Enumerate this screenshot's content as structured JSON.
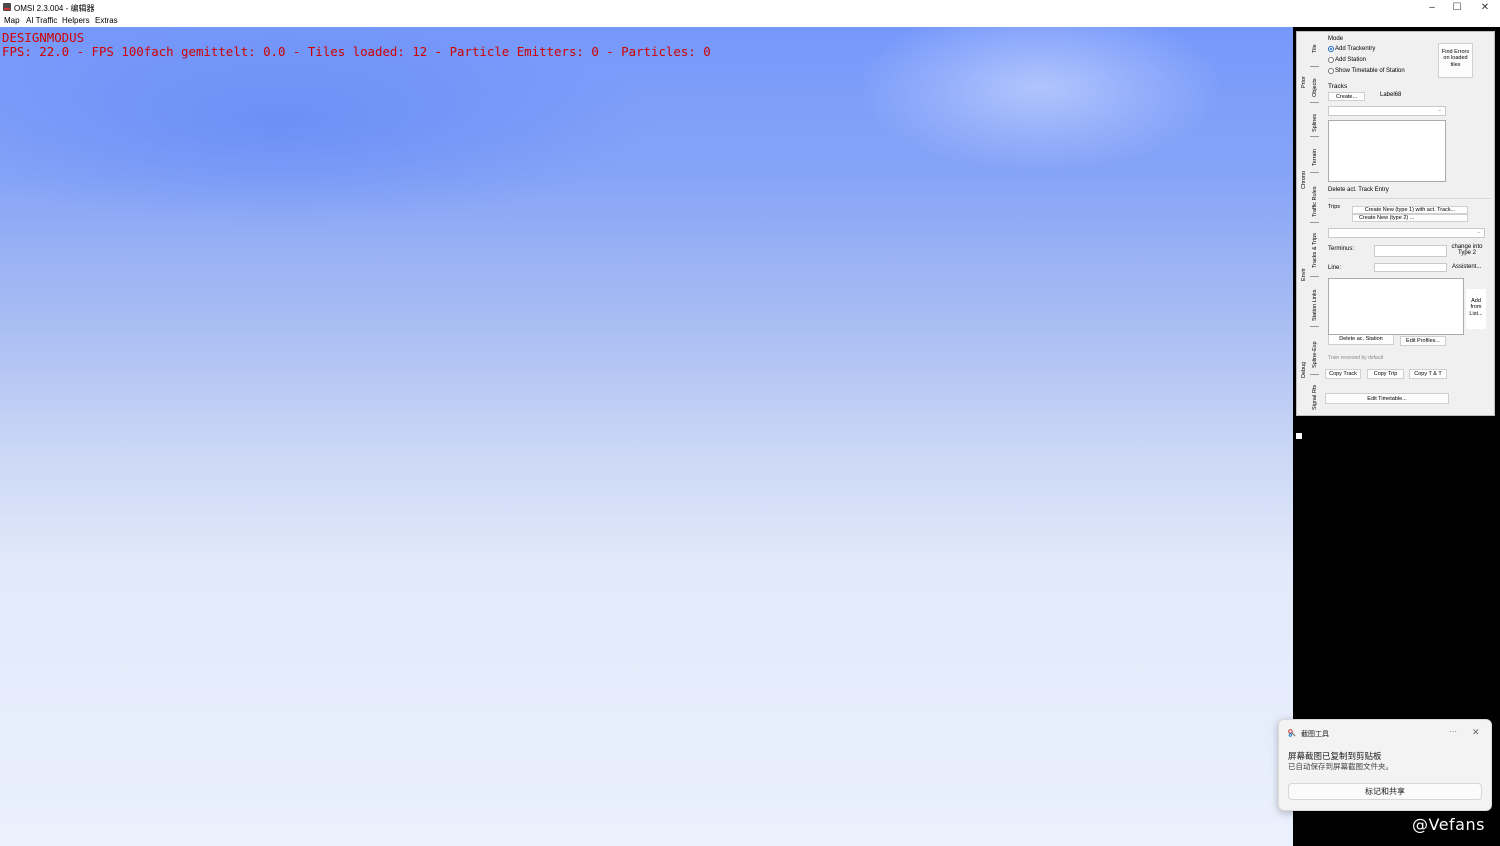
{
  "window": {
    "title": "OMSI 2.3.004 - 编辑器",
    "minimize_glyph": "–",
    "maximize_glyph": "☐",
    "close_glyph": "✕"
  },
  "menu": [
    "Map",
    "AI Traffic",
    "Helpers",
    "Extras"
  ],
  "overlay": {
    "mode": "DESIGNMODUS",
    "stats": "FPS: 22.0 - FPS 100fach gemittelt: 0.0 - Tiles loaded: 12 - Particle Emitters: 0 - Particles: 0",
    "color": "#d00000"
  },
  "tabs_outer": [
    "Tile",
    "Objects",
    "Splines",
    "Terrain",
    "Traffic Rules",
    "Tracks & Trips",
    "Station Links",
    "Spline-Exp",
    "Signal Rts"
  ],
  "tabs_inner": [
    "Prior",
    "Chrono",
    "Envir",
    "Debug"
  ],
  "panel": {
    "mode_label": "Mode",
    "mode_options": [
      "Add Trackentry",
      "Add Station",
      "Show Timetable of Station"
    ],
    "selected_mode": "Add Trackentry",
    "find_errors": "Find Errors on loaded tiles",
    "tracks_label": "Tracks",
    "create_button": "Create...",
    "label68": "Label68",
    "delete_track_entry": "Delete act. Track Entry",
    "trips_label": "Trips",
    "create_new_type1": "Create New  (type 1) with act. Track...",
    "create_new_type2": "Create New  (type 2) ...",
    "terminus_label": "Terminus:",
    "line_label": "Line:",
    "change_into_type2": "change into Type 2",
    "assistent": "Assistent...",
    "add_from_list": "Add from List...",
    "delete_station": "Delete ac. Station",
    "edit_profiles": "Edit Profiles...",
    "train_reversed": "Train reversed by default",
    "copy_track": "Copy Track",
    "copy_trip": "Copy Trip",
    "copy_tt": "Copy T & T",
    "edit_timetable": "Edit Timetable..."
  },
  "toast": {
    "app_name": "截图工具",
    "more": "···",
    "close": "✕",
    "heading": "屏幕截图已复制到剪贴板",
    "body": "已自动保存到屏幕截图文件夹。",
    "action": "标记和共享"
  },
  "watermark": "@Vefans"
}
